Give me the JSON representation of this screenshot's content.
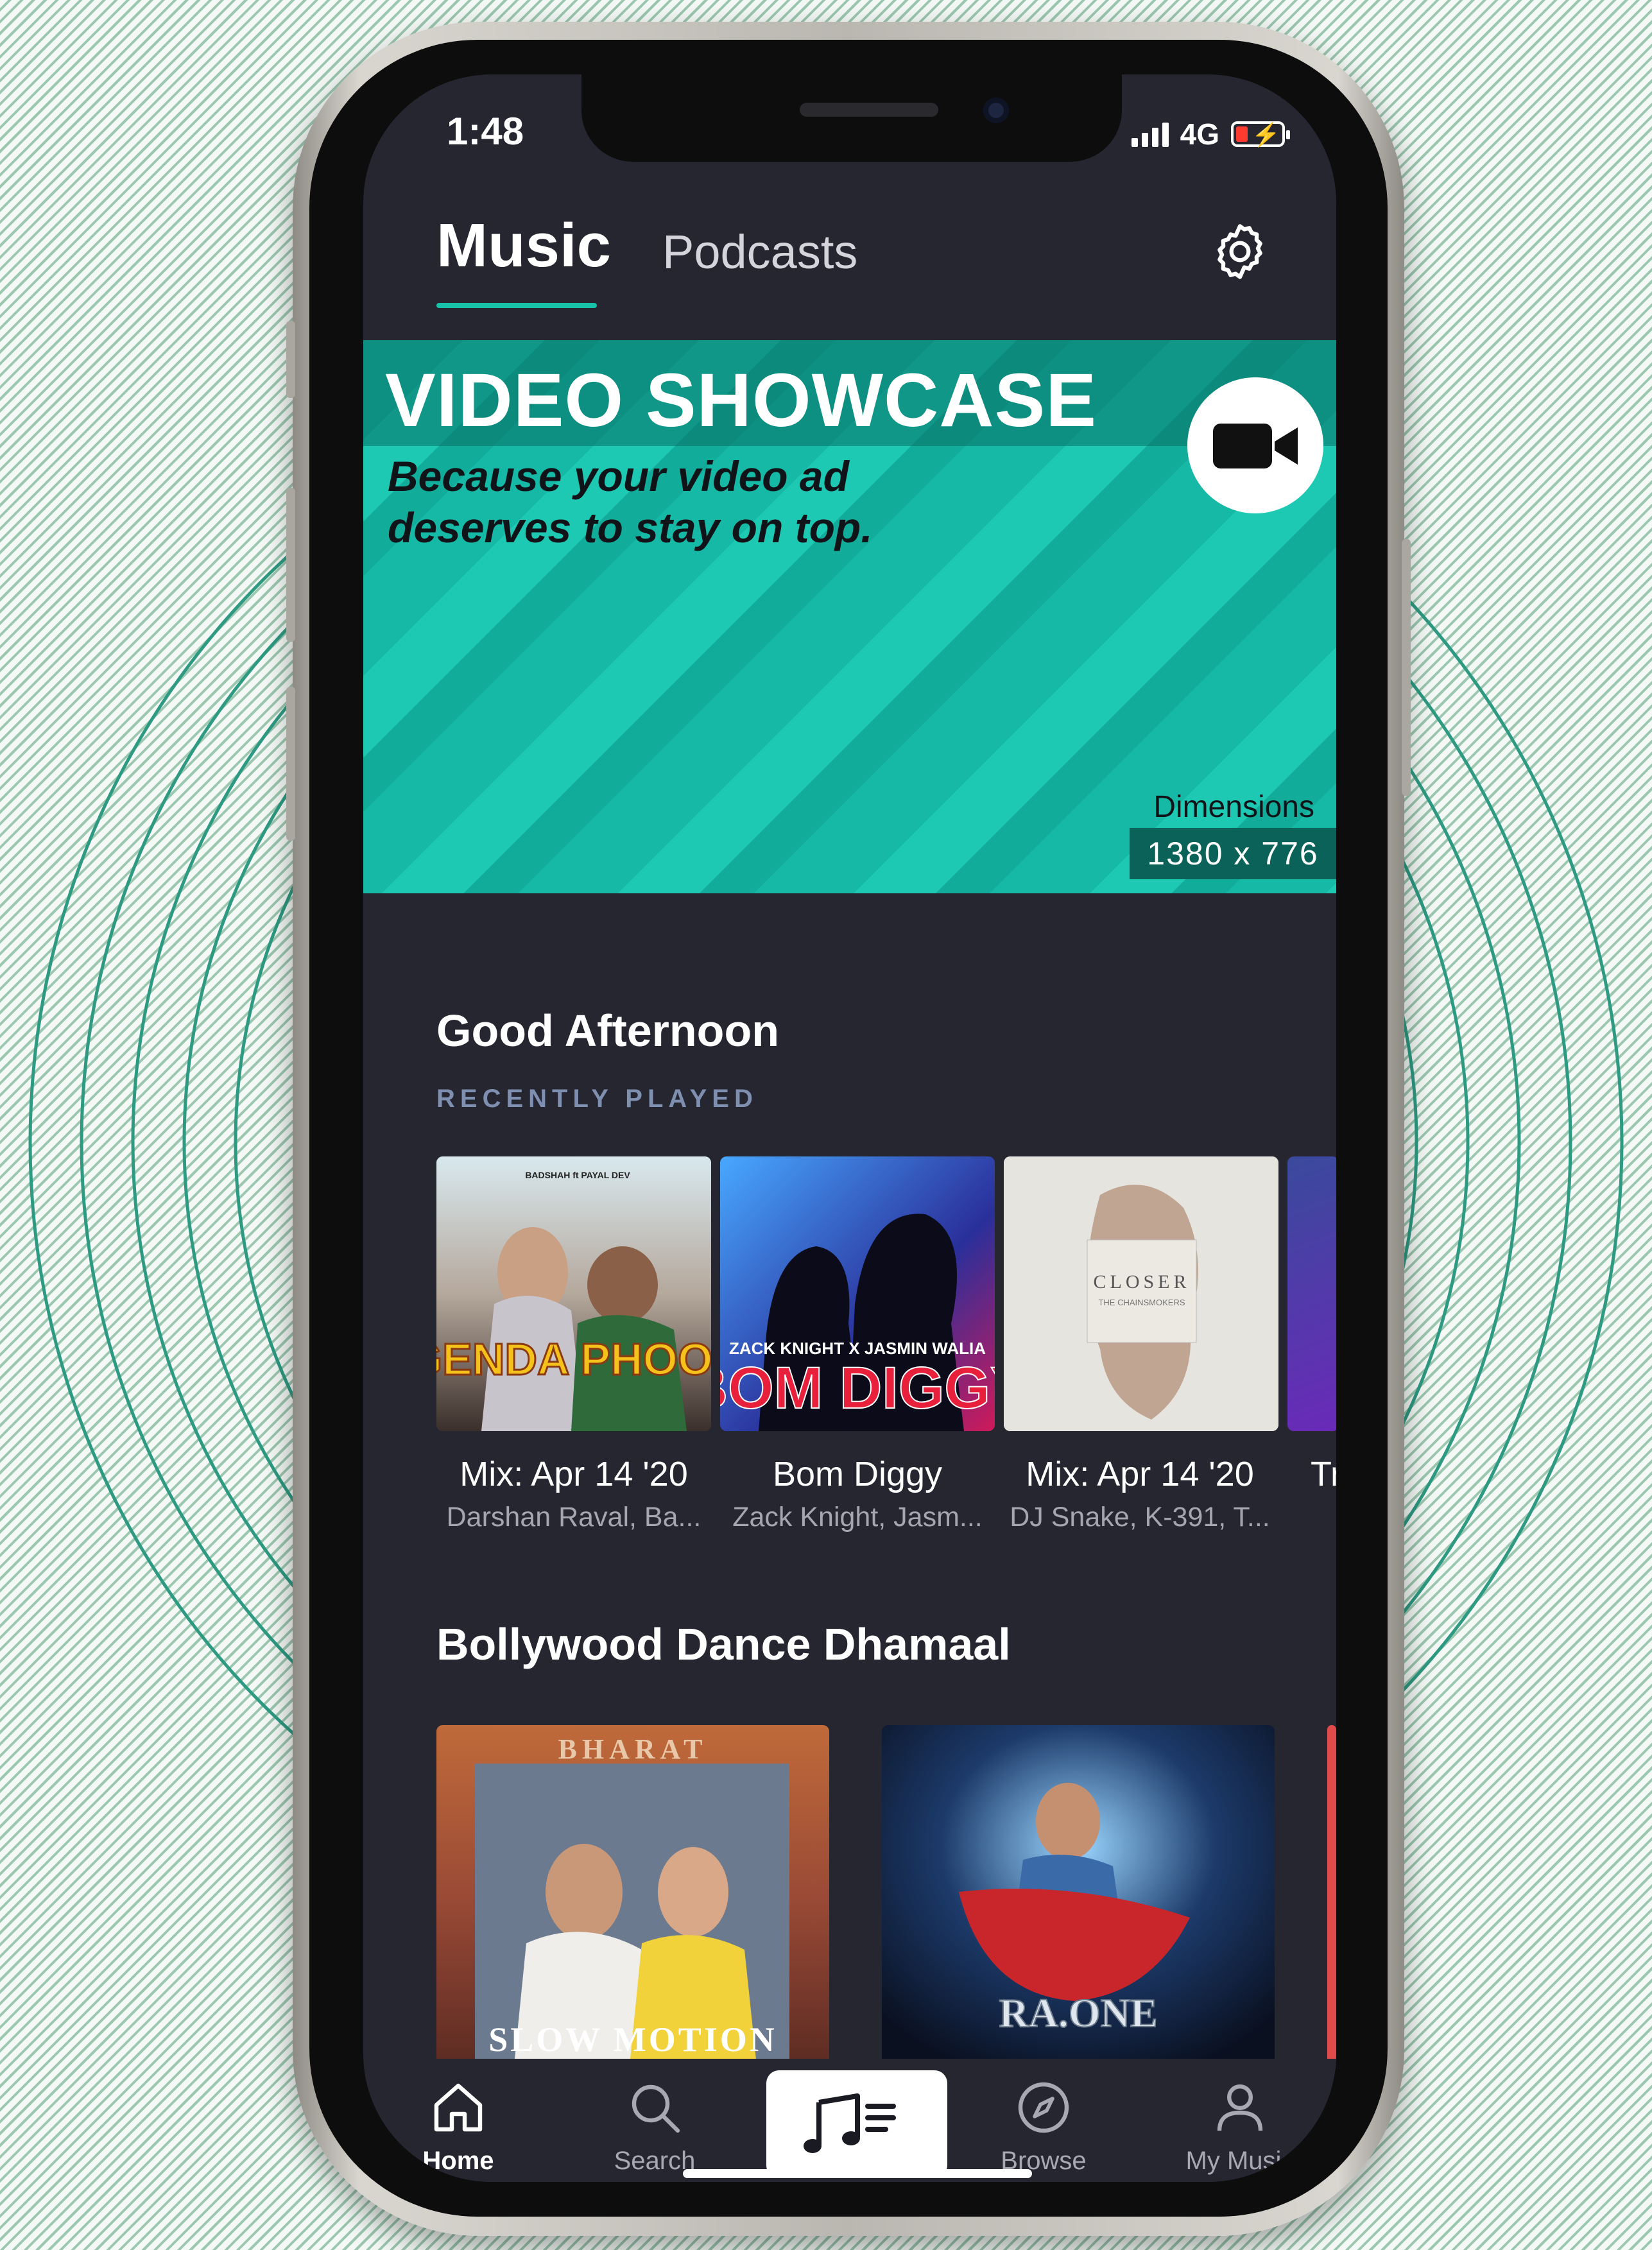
{
  "status_bar": {
    "time": "1:48",
    "network": "4G",
    "battery_state": "low-charging"
  },
  "header": {
    "tabs": [
      {
        "label": "Music",
        "active": true
      },
      {
        "label": "Podcasts",
        "active": false
      }
    ],
    "settings_icon": "gear-icon",
    "accent": "#18c2a8"
  },
  "banner": {
    "title": "VIDEO SHOWCASE",
    "subtitle_line1": "Because your video ad",
    "subtitle_line2": "deserves to stay on top.",
    "dimensions_label": "Dimensions",
    "dimensions_value": "1380 x 776",
    "icon": "video-camera-icon"
  },
  "recently_played": {
    "greeting": "Good Afternoon",
    "label": "RECENTLY PLAYED",
    "items": [
      {
        "title": "Mix: Apr 14 '20",
        "subtitle": "Darshan Raval, Ba...",
        "art_text": "GENDA PHOOL",
        "art_top": "BADSHAH ft PAYAL DEV"
      },
      {
        "title": "Bom Diggy",
        "subtitle": "Zack Knight,  Jasm...",
        "art_text": "BOM DIGGY",
        "art_top": "ZACK KNIGHT X JASMIN WALIA"
      },
      {
        "title": "Mix: Apr 14 '20",
        "subtitle": "DJ Snake, K-391, T...",
        "art_text": "CLOSER",
        "art_top": "THE CHAINSMOKERS"
      },
      {
        "title": "Tr",
        "subtitle": ""
      }
    ]
  },
  "playlist": {
    "title": "Bollywood Dance Dhamaal",
    "items": [
      {
        "art_top": "BHARAT",
        "art_text": "SLOW MOTION"
      },
      {
        "art_text": "RA.ONE"
      }
    ]
  },
  "bottom_nav": {
    "items": [
      {
        "label": "Home",
        "icon": "home-icon",
        "active": true
      },
      {
        "label": "Search",
        "icon": "search-icon",
        "active": false
      },
      {
        "label": "",
        "icon": "music-player-icon",
        "active": false
      },
      {
        "label": "Browse",
        "icon": "compass-icon",
        "active": false
      },
      {
        "label": "My Music",
        "icon": "user-icon",
        "active": false
      }
    ]
  }
}
